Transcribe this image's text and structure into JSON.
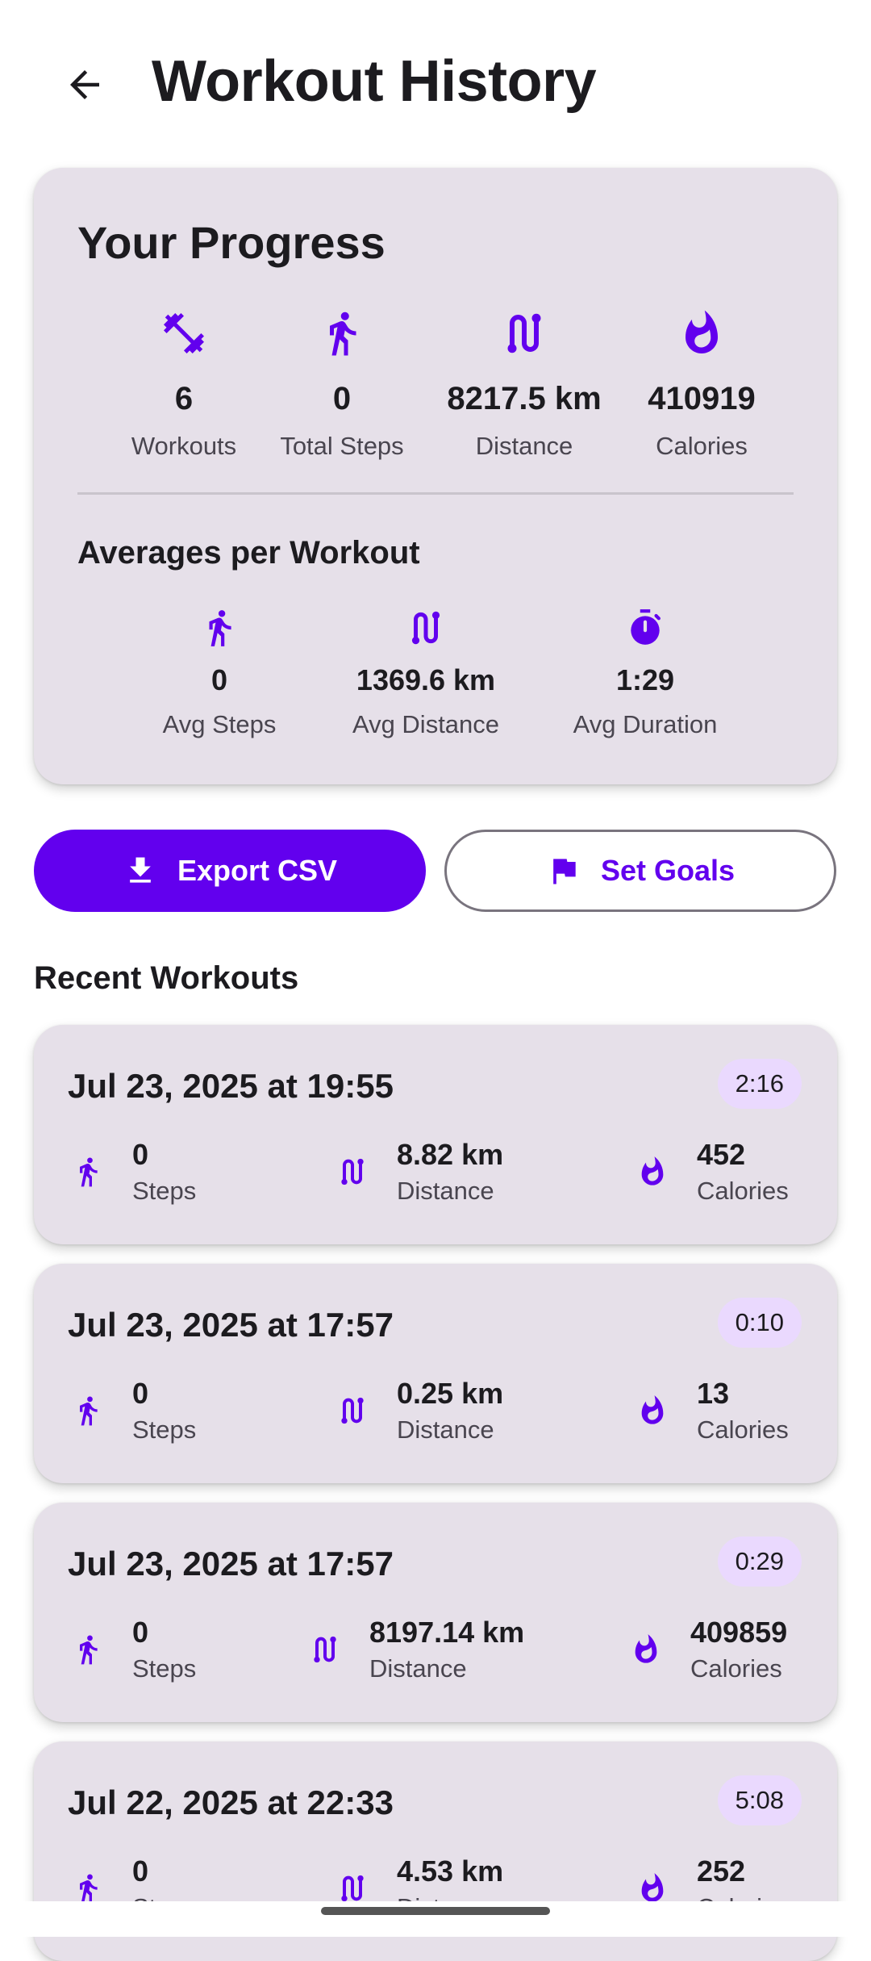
{
  "header": {
    "title": "Workout History",
    "back_icon": "arrow-back-icon"
  },
  "colors": {
    "accent": "#6200ee",
    "card_bg": "#e6e0e9",
    "badge_bg": "#ead9fe"
  },
  "progress": {
    "title": "Your Progress",
    "stats": [
      {
        "icon": "dumbbell-icon",
        "value": "6",
        "label": "Workouts"
      },
      {
        "icon": "walk-icon",
        "value": "0",
        "label": "Total Steps"
      },
      {
        "icon": "route-icon",
        "value": "8217.5 km",
        "label": "Distance"
      },
      {
        "icon": "flame-icon",
        "value": "410919",
        "label": "Calories"
      }
    ],
    "averages_title": "Averages per Workout",
    "averages": [
      {
        "icon": "walk-icon",
        "value": "0",
        "label": "Avg Steps"
      },
      {
        "icon": "route-icon",
        "value": "1369.6 km",
        "label": "Avg Distance"
      },
      {
        "icon": "timer-icon",
        "value": "1:29",
        "label": "Avg Duration"
      }
    ]
  },
  "actions": {
    "export_label": "Export CSV",
    "goals_label": "Set Goals"
  },
  "recent": {
    "title": "Recent Workouts",
    "workouts": [
      {
        "date": "Jul 23, 2025 at 19:55",
        "duration": "2:16",
        "steps": "0",
        "steps_label": "Steps",
        "distance": "8.82 km",
        "distance_label": "Distance",
        "calories": "452",
        "calories_label": "Calories"
      },
      {
        "date": "Jul 23, 2025 at 17:57",
        "duration": "0:10",
        "steps": "0",
        "steps_label": "Steps",
        "distance": "0.25 km",
        "distance_label": "Distance",
        "calories": "13",
        "calories_label": "Calories"
      },
      {
        "date": "Jul 23, 2025 at 17:57",
        "duration": "0:29",
        "steps": "0",
        "steps_label": "Steps",
        "distance": "8197.14 km",
        "distance_label": "Distance",
        "calories": "409859",
        "calories_label": "Calories"
      },
      {
        "date": "Jul 22, 2025 at 22:33",
        "duration": "5:08",
        "steps": "0",
        "steps_label": "Steps",
        "distance": "4.53 km",
        "distance_label": "Distance",
        "calories": "252",
        "calories_label": "Calories"
      }
    ]
  }
}
